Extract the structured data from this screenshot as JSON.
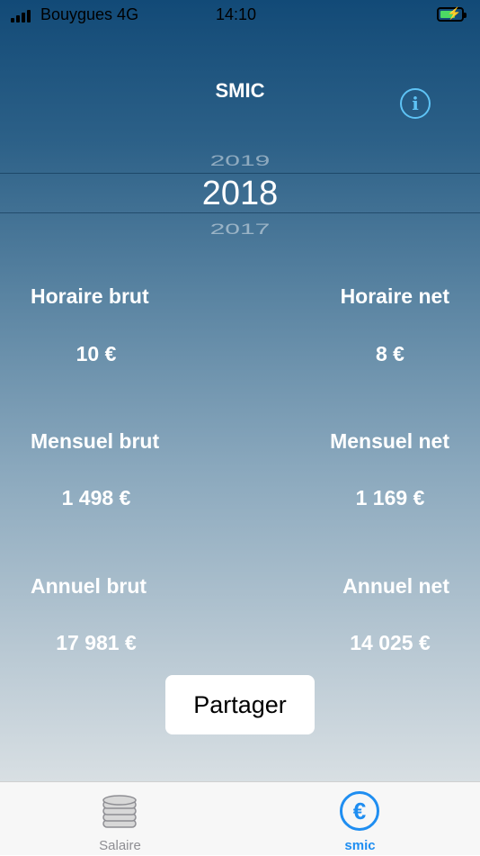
{
  "status": {
    "carrier": "Bouygues 4G",
    "time": "14:10",
    "signal_icon": "signal-bars-icon",
    "battery_icon": "battery-charging-icon"
  },
  "header": {
    "title": "SMIC",
    "info_icon": "info-icon",
    "info_glyph": "i"
  },
  "picker": {
    "years": [
      "2019",
      "2018",
      "2017"
    ],
    "selected": "2018"
  },
  "results": {
    "horaire_brut_label": "Horaire brut",
    "horaire_brut_value": "10 €",
    "horaire_net_label": "Horaire net",
    "horaire_net_value": "8 €",
    "mensuel_brut_label": "Mensuel brut",
    "mensuel_brut_value": "1 498 €",
    "mensuel_net_label": "Mensuel net",
    "mensuel_net_value": "1 169 €",
    "annuel_brut_label": "Annuel brut",
    "annuel_brut_value": "17 981 €",
    "annuel_net_label": "Annuel net",
    "annuel_net_value": "14 025 €"
  },
  "share_button": "Partager",
  "tabs": [
    {
      "label": "Salaire",
      "icon": "coins-icon",
      "active": false
    },
    {
      "label": "smic",
      "icon": "euro-circle-icon",
      "active": true
    }
  ],
  "colors": {
    "accent": "#1f8ef1",
    "info": "#5ec3f5",
    "battery": "#4cd964"
  }
}
